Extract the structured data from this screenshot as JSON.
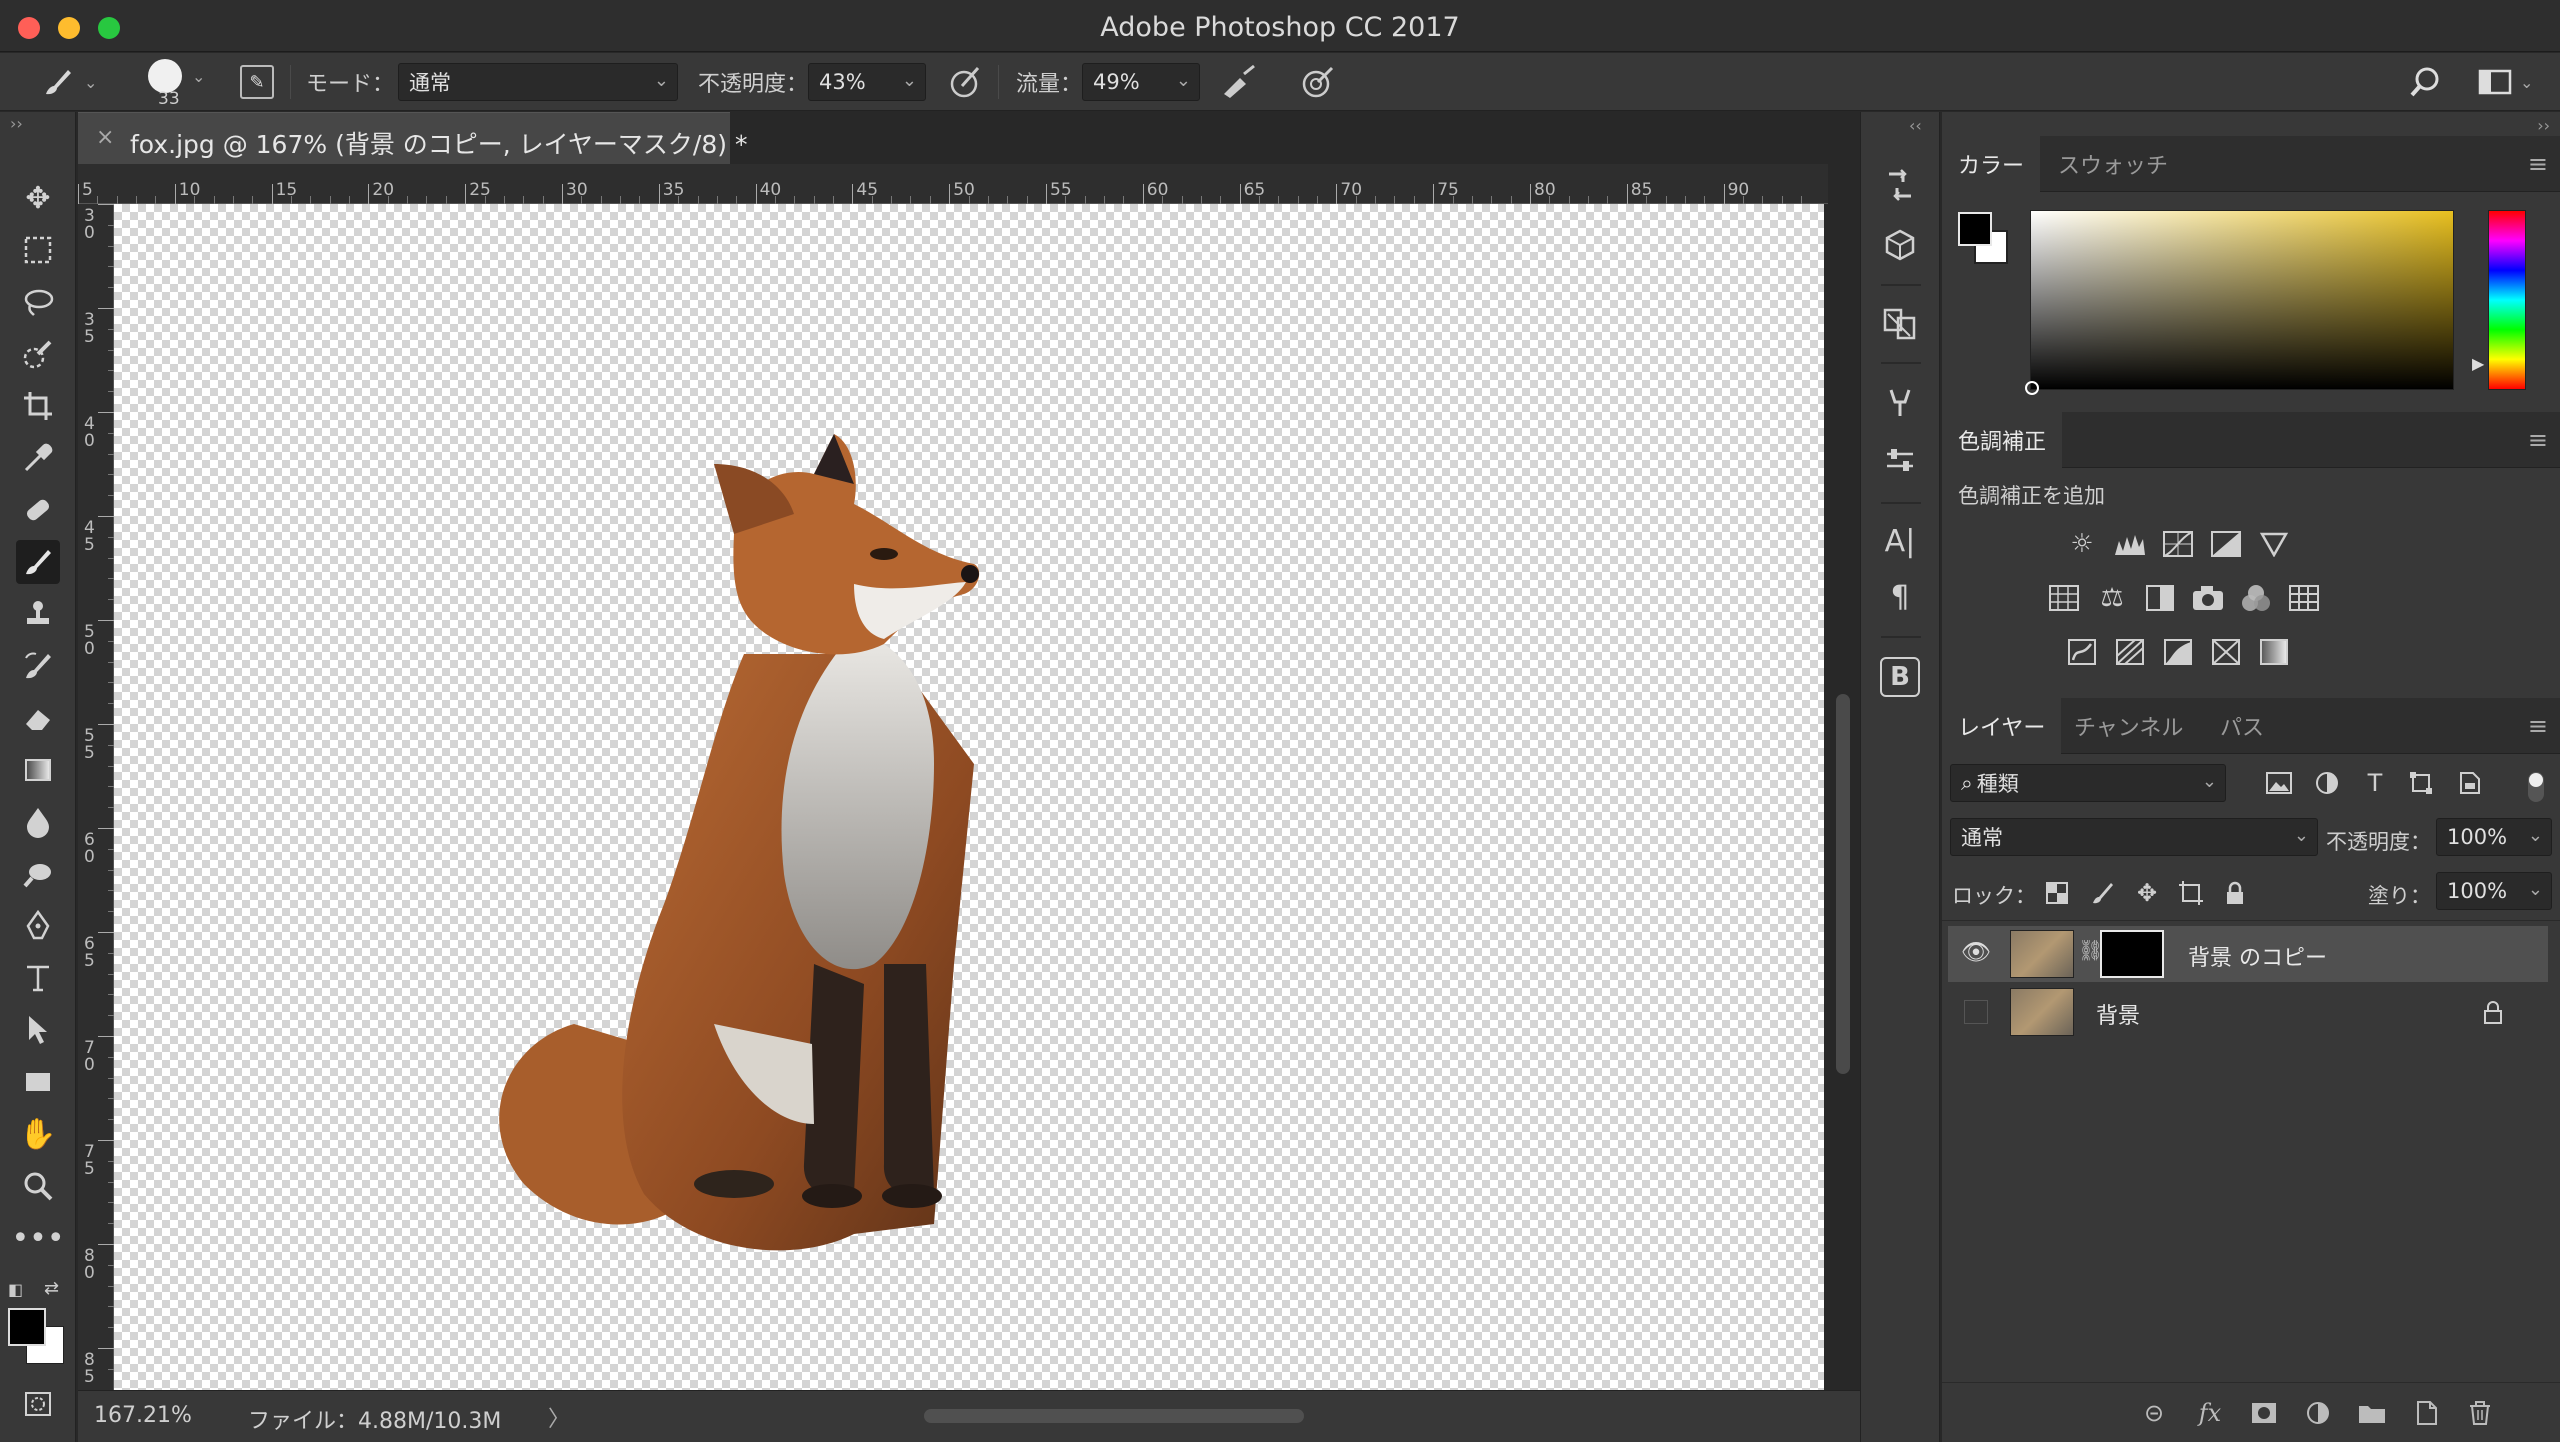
{
  "window": {
    "title": "Adobe Photoshop CC 2017"
  },
  "options_bar": {
    "brush_size": "33",
    "mode_label": "モード：",
    "mode_value": "通常",
    "opacity_label": "不透明度：",
    "opacity_value": "43%",
    "flow_label": "流量：",
    "flow_value": "49%"
  },
  "document": {
    "tab_title": "fox.jpg @ 167% (背景 のコピー, レイヤーマスク/8) *",
    "close_glyph": "×"
  },
  "rulers": {
    "horizontal": [
      "5",
      "10",
      "15",
      "20",
      "25",
      "30",
      "35",
      "40",
      "45",
      "50",
      "55",
      "60",
      "65",
      "70",
      "75",
      "80",
      "85",
      "90"
    ],
    "vertical": [
      "30",
      "35",
      "40",
      "45",
      "50",
      "55",
      "60",
      "65",
      "70",
      "75",
      "80",
      "85"
    ]
  },
  "status": {
    "zoom": "167.21%",
    "file_info": "ファイル：4.88M/10.3M",
    "arrow": "〉"
  },
  "color_panel": {
    "tabs": [
      "カラー",
      "スウォッチ"
    ],
    "foreground": "#000000",
    "background": "#ffffff"
  },
  "adjustments_panel": {
    "tab": "色調補正",
    "subtitle": "色調補正を追加"
  },
  "layers_panel": {
    "tabs": [
      "レイヤー",
      "チャンネル",
      "パス"
    ],
    "filter_value": "種類",
    "blend_mode": "通常",
    "opacity_label": "不透明度：",
    "opacity_value": "100%",
    "lock_label": "ロック：",
    "fill_label": "塗り：",
    "fill_value": "100%",
    "layers": [
      {
        "name": "背景 のコピー",
        "visible": true,
        "has_mask": true,
        "selected": true
      },
      {
        "name": "背景",
        "visible": false,
        "has_mask": false,
        "locked": true
      }
    ]
  },
  "icons": {
    "toolbar": [
      "move-icon",
      "marquee-icon",
      "lasso-icon",
      "quick-select-icon",
      "crop-icon",
      "eyedropper-icon",
      "healing-icon",
      "brush-icon",
      "stamp-icon",
      "history-brush-icon",
      "eraser-icon",
      "gradient-icon",
      "blur-icon",
      "dodge-icon",
      "pen-icon",
      "type-icon",
      "path-select-icon",
      "rectangle-icon",
      "hand-icon",
      "zoom-icon",
      "more-tools-icon"
    ]
  }
}
